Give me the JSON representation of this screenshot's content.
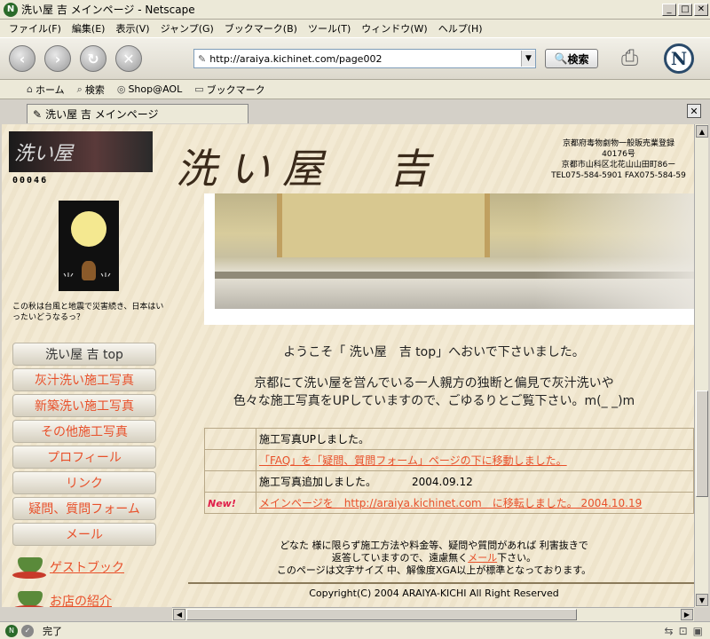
{
  "window": {
    "title": "洗い屋 吉 メインページ - Netscape",
    "app_icon": "N"
  },
  "menu": [
    "ファイル(F)",
    "編集(E)",
    "表示(V)",
    "ジャンプ(G)",
    "ブックマーク(B)",
    "ツール(T)",
    "ウィンドウ(W)",
    "ヘルプ(H)"
  ],
  "address": {
    "url": "http://araiya.kichinet.com/page002"
  },
  "toolbar": {
    "search_label": "検索",
    "logo": "N"
  },
  "personal_toolbar": {
    "home": "ホーム",
    "search": "検索",
    "shop": "Shop@AOL",
    "bookmarks": "ブックマーク"
  },
  "tab": {
    "title": "洗い屋 吉 メインページ"
  },
  "site": {
    "logo_text": "洗い屋",
    "counter": "00046",
    "caption": "この秋は台風と地震で災害続き、日本はいったいどうなるっ？",
    "title": "洗い屋　吉",
    "info": [
      "京都府毒物劇物一般販売業登録",
      "40176号",
      "京都市山科区北花山山田町86ー",
      "TEL075-584-5901 FAX075-584-59"
    ],
    "nav": [
      "洗い屋 吉 top",
      "灰汁洗い施工写真",
      "新築洗い施工写真",
      "その他施工写真",
      "プロフィール",
      "リンク",
      "疑問、質問フォーム",
      "メール"
    ],
    "guestbook": "ゲストブック",
    "shop_intro": "お店の紹介",
    "welcome": "ようこそ「 洗い屋　吉 top」へおいで下さいました。",
    "intro_1": "京都にて洗い屋を営んでいる一人親方の独断と偏見で灰汁洗いや",
    "intro_2": "色々な施工写真をUPしていますので、ごゆるりとご覧下さい。m(_ _)m",
    "news": [
      {
        "badge": "",
        "text": "施工写真UPしました。",
        "date": "",
        "link": false
      },
      {
        "badge": "",
        "text": "「FAQ」を「疑問、質問フォーム」ページの下に移動しました。",
        "date": "",
        "link": true
      },
      {
        "badge": "",
        "text": "施工写真追加しました。",
        "date": "2004.09.12",
        "link": false
      },
      {
        "badge": "New!",
        "text": "メインページを　http://araiya.kichinet.com　に移転しました。 2004.10.19",
        "date": "",
        "link": true
      }
    ],
    "notice_1": "どなた 様に限らず施工方法や料金等、疑問や質問があれば 利害抜きで",
    "notice_2a": "返答していますので、遠慮無く",
    "notice_mail": "メール",
    "notice_2b": "下さい。",
    "notice_3": "このページは文字サイズ 中、解像度XGA以上が標準となっております。",
    "copyright": "Copyright(C) 2004 ARAIYA-KICHI All Right Reserved"
  },
  "status": {
    "text": "完了"
  }
}
